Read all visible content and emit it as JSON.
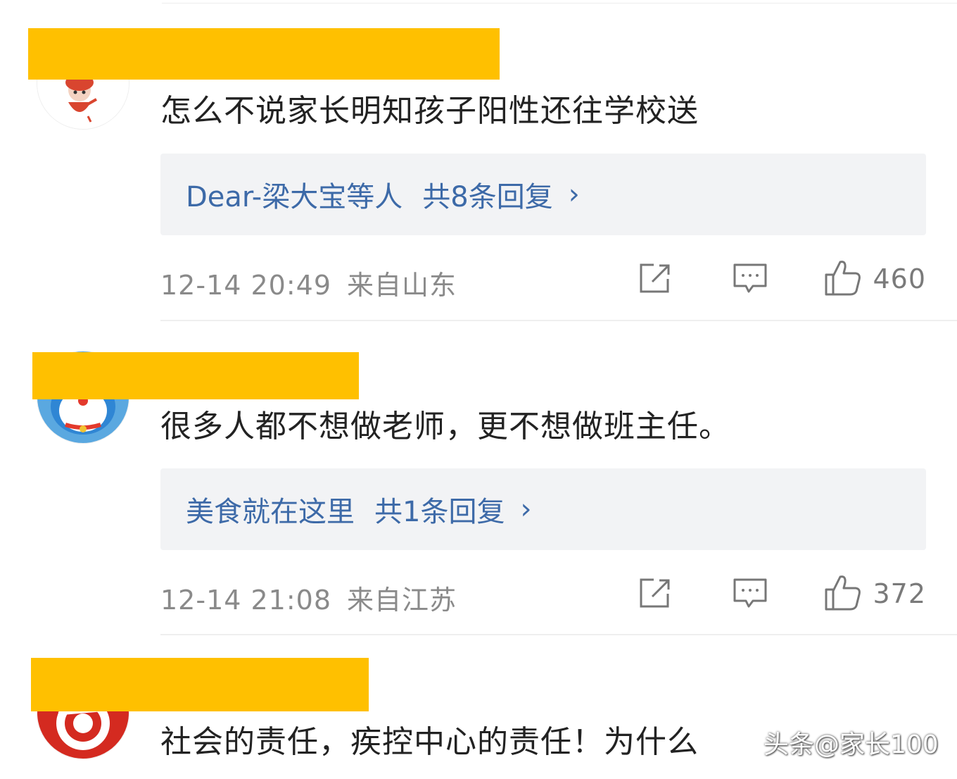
{
  "comments": [
    {
      "text": "怎么不说家长明知孩子阳性还往学校送",
      "reply_preview": {
        "names": "Dear-梁大宝等人",
        "count_label": "共8条回复",
        "chevron": "›"
      },
      "timestamp": "12-14 20:49",
      "location": "来自山东",
      "likes": "460"
    },
    {
      "text": "很多人都不想做老师，更不想做班主任。",
      "reply_preview": {
        "names": "美食就在这里",
        "count_label": "共1条回复",
        "chevron": "›"
      },
      "timestamp": "12-14 21:08",
      "location": "来自江苏",
      "likes": "372"
    },
    {
      "text": "社会的责任，疾控中心的责任！为什么"
    }
  ],
  "watermark": "头条@家长100",
  "colors": {
    "redaction": "#ffc000",
    "reply_link": "#3d6aa8",
    "reply_bg": "#f2f3f5",
    "meta": "#8a8a8a"
  },
  "icons": [
    "share-icon",
    "comment-icon",
    "like-icon",
    "chevron-right-icon"
  ]
}
